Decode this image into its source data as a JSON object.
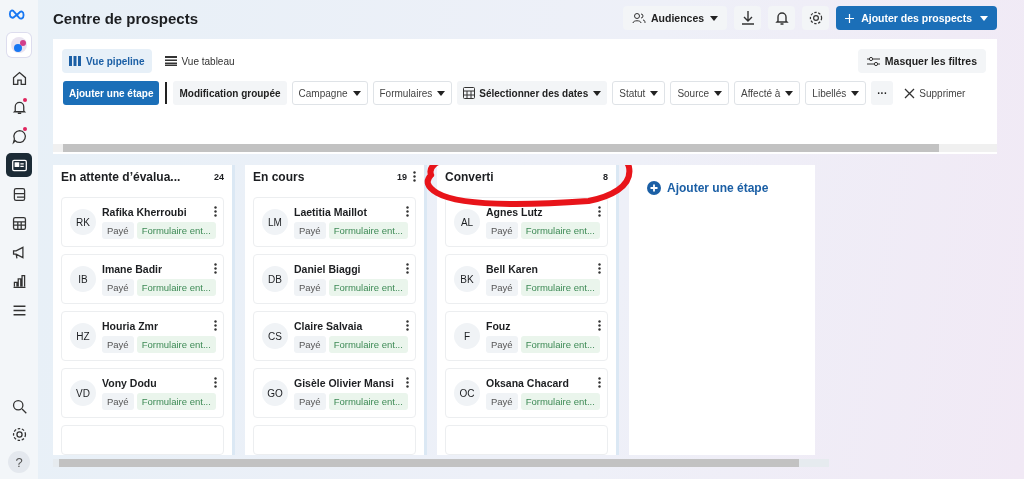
{
  "sidebar": {
    "items": [
      {
        "selected": false,
        "notification": false
      },
      {
        "selected": false,
        "notification": true
      },
      {
        "selected": false,
        "notification": true
      },
      {
        "selected": true,
        "notification": false
      },
      {
        "selected": false,
        "notification": false
      },
      {
        "selected": false,
        "notification": false
      },
      {
        "selected": false,
        "notification": false
      },
      {
        "selected": false,
        "notification": false
      },
      {
        "selected": false,
        "notification": false
      }
    ],
    "bottom_help": "?"
  },
  "header": {
    "title": "Centre de prospects",
    "audiences": "Audiences",
    "add_button": "Ajouter des prospects"
  },
  "views": [
    {
      "label": "Vue pipeline",
      "selected": true
    },
    {
      "label": "Vue tableau",
      "selected": false
    }
  ],
  "hide_filters": "Masquer les filtres",
  "toolbar": [
    {
      "kind": "primary",
      "label": "Ajouter une étape"
    },
    {
      "kind": "plain",
      "label": "Modification groupée"
    },
    {
      "kind": "dropdown",
      "label": "Campagne"
    },
    {
      "kind": "dropdown",
      "label": "Formulaires"
    },
    {
      "kind": "date",
      "label": "Sélectionner des dates"
    },
    {
      "kind": "dropdown",
      "label": "Statut"
    },
    {
      "kind": "dropdown",
      "label": "Source"
    },
    {
      "kind": "dropdown",
      "label": "Affecté à"
    },
    {
      "kind": "dropdown",
      "label": "Libellés"
    },
    {
      "kind": "more",
      "label": "···"
    },
    {
      "kind": "clear",
      "label": "Supprimer"
    }
  ],
  "columns": [
    {
      "title": "En attente d’évalua...",
      "count": "24",
      "menu": false,
      "circled": false,
      "cards": [
        {
          "initials": "RK",
          "name": "Rafika Kherroubi",
          "tags": [
            "Payé",
            "Formulaire ent..."
          ]
        },
        {
          "initials": "IB",
          "name": "Imane Badir",
          "tags": [
            "Payé",
            "Formulaire ent..."
          ]
        },
        {
          "initials": "HZ",
          "name": "Houria Zmr",
          "tags": [
            "Payé",
            "Formulaire ent..."
          ]
        },
        {
          "initials": "VD",
          "name": "Vony Dodu",
          "tags": [
            "Payé",
            "Formulaire ent..."
          ]
        }
      ]
    },
    {
      "title": "En cours",
      "count": "19",
      "menu": true,
      "circled": false,
      "cards": [
        {
          "initials": "LM",
          "name": "Laetitia Maillot",
          "tags": [
            "Payé",
            "Formulaire ent..."
          ]
        },
        {
          "initials": "DB",
          "name": "Daniel Biaggi",
          "tags": [
            "Payé",
            "Formulaire ent..."
          ]
        },
        {
          "initials": "CS",
          "name": "Claire Salvaia",
          "tags": [
            "Payé",
            "Formulaire ent..."
          ]
        },
        {
          "initials": "GO",
          "name": "Gisèle Olivier Mansi",
          "tags": [
            "Payé",
            "Formulaire ent..."
          ]
        }
      ]
    },
    {
      "title": "Converti",
      "count": "8",
      "menu": false,
      "circled": true,
      "cards": [
        {
          "initials": "AL",
          "name": "Agnes Lutz",
          "tags": [
            "Payé",
            "Formulaire ent..."
          ]
        },
        {
          "initials": "BK",
          "name": "Bell Karen",
          "tags": [
            "Payé",
            "Formulaire ent..."
          ]
        },
        {
          "initials": "F",
          "name": "Fouz",
          "tags": [
            "Payé",
            "Formulaire ent..."
          ]
        },
        {
          "initials": "OC",
          "name": "Oksana Chacard",
          "tags": [
            "Payé",
            "Formulaire ent..."
          ]
        }
      ]
    }
  ],
  "add_stage": "Ajouter une étape"
}
